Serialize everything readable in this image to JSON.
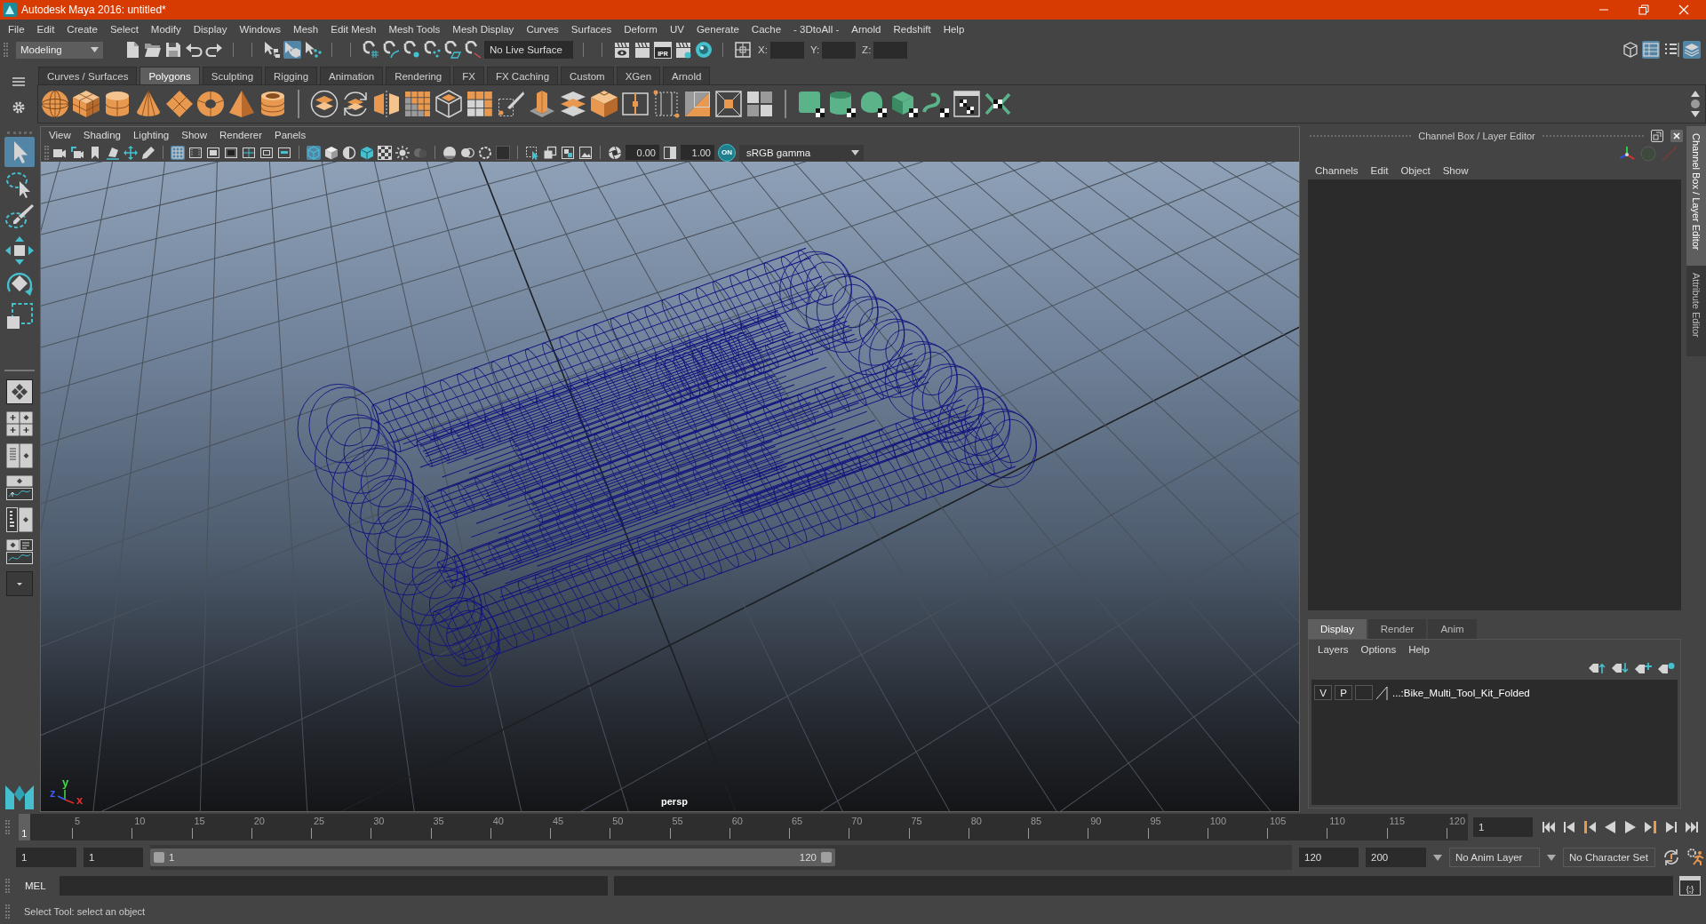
{
  "window": {
    "title": "Autodesk Maya 2016: untitled*"
  },
  "menu_bar": [
    "File",
    "Edit",
    "Create",
    "Select",
    "Modify",
    "Display",
    "Windows",
    "Mesh",
    "Edit Mesh",
    "Mesh Tools",
    "Mesh Display",
    "Curves",
    "Surfaces",
    "Deform",
    "UV",
    "Generate",
    "Cache",
    "- 3DtoAll -",
    "Arnold",
    "Redshift",
    "Help"
  ],
  "status_line": {
    "menu_set": "Modeling",
    "selection_modes": [
      {
        "selected": false
      },
      {
        "selected": true
      },
      {
        "selected": false
      }
    ],
    "live_surface": "No Live Surface",
    "render_button": "IPR",
    "coordinate_fields": [
      {
        "label": "X:"
      },
      {
        "label": "Y:"
      },
      {
        "label": "Z:"
      }
    ],
    "panel_toggles": [
      {
        "selected": false
      },
      {
        "selected": true
      },
      {
        "selected": false
      },
      {
        "selected": true
      }
    ]
  },
  "shelf": {
    "tabs": [
      {
        "label": "Curves / Surfaces",
        "selected": false
      },
      {
        "label": "Polygons",
        "selected": true
      },
      {
        "label": "Sculpting",
        "selected": false
      },
      {
        "label": "Rigging",
        "selected": false
      },
      {
        "label": "Animation",
        "selected": false
      },
      {
        "label": "Rendering",
        "selected": false
      },
      {
        "label": "FX",
        "selected": false
      },
      {
        "label": "FX Caching",
        "selected": false
      },
      {
        "label": "Custom",
        "selected": false
      },
      {
        "label": "XGen",
        "selected": false
      },
      {
        "label": "Arnold",
        "selected": false
      }
    ]
  },
  "toolbox": {
    "tools": [
      {
        "selected": true
      },
      {
        "selected": false
      },
      {
        "selected": false
      },
      {
        "selected": false
      },
      {
        "selected": false
      },
      {
        "selected": false
      }
    ]
  },
  "viewport": {
    "menu": [
      "View",
      "Shading",
      "Lighting",
      "Show",
      "Renderer",
      "Panels"
    ],
    "display_toggles": [
      {
        "selected": true
      },
      {
        "selected": false
      },
      {
        "selected": false
      },
      {
        "selected": false
      },
      {
        "selected": false
      },
      {
        "selected": false
      },
      {
        "selected": false
      }
    ],
    "shading_toggles": [
      {
        "selected": true
      },
      {
        "selected": false
      },
      {
        "selected": false
      },
      {
        "selected": false
      },
      {
        "selected": false
      },
      {
        "selected": false
      },
      {
        "selected": false
      }
    ],
    "exposure": "0.00",
    "gamma": "1.00",
    "color_management": "ON",
    "color_space": "sRGB gamma",
    "axis_labels": [
      {
        "label": "y",
        "color": "#3fdc4a"
      },
      {
        "label": "z",
        "color": "#3a5bff"
      },
      {
        "label": "x",
        "color": "#e03030"
      }
    ],
    "camera": "persp"
  },
  "channel_box": {
    "title": "Channel Box / Layer Editor",
    "menu": [
      "Channels",
      "Edit",
      "Object",
      "Show"
    ]
  },
  "layer_editor": {
    "tabs": [
      {
        "label": "Display",
        "selected": true
      },
      {
        "label": "Render",
        "selected": false
      },
      {
        "label": "Anim",
        "selected": false
      }
    ],
    "menu": [
      "Layers",
      "Options",
      "Help"
    ],
    "layers": [
      {
        "visibility": "V",
        "playback": "P",
        "name": "...:Bike_Multi_Tool_Kit_Folded"
      }
    ]
  },
  "side_tabs": [
    {
      "label": "Channel Box / Layer Editor",
      "selected": true
    },
    {
      "label": "Attribute Editor",
      "selected": false
    }
  ],
  "time_slider": {
    "ticks": [
      "5",
      "10",
      "15",
      "20",
      "25",
      "30",
      "35",
      "40",
      "45",
      "50",
      "55",
      "60",
      "65",
      "70",
      "75",
      "80",
      "85",
      "90",
      "95",
      "100",
      "105",
      "110",
      "115",
      "120"
    ],
    "current_frame": "1",
    "level": 0,
    "frame_field": "1"
  },
  "range_slider": {
    "start_field": "1",
    "playback_start_field": "1",
    "range_start": "1",
    "range_end": "120",
    "level": 0.6,
    "playback_end_field": "120",
    "end_field": "200",
    "anim_layer": "No Anim Layer",
    "character_set": "No Character Set"
  },
  "command_line": {
    "language": "MEL",
    "script_editor": "{;}"
  },
  "help_line": "Select Tool: select an object"
}
